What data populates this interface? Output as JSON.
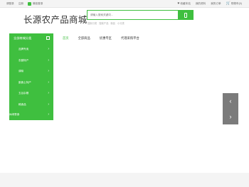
{
  "topbar": {
    "left": [
      "请登录",
      "注册"
    ],
    "wechat_label": "微信登录",
    "right": [
      {
        "icon": "heart-icon",
        "label": "收藏本站"
      },
      {
        "label": "我的资料"
      },
      {
        "label": "我的订单"
      }
    ],
    "cart_label": "购物车",
    "cart_count": "(0)"
  },
  "header": {
    "logo": "长源农产品商城",
    "search_placeholder": "请输入搜索关键词...",
    "hot_words": [
      "搜索分类",
      "搜索产品",
      "新品",
      "小分类"
    ]
  },
  "nav": {
    "category_head": "全部商城分类",
    "links": [
      "首页",
      "全部商品",
      "优惠专区",
      "代理采购平台"
    ],
    "active_index": 0
  },
  "categories": [
    {
      "label": "品牌专卖"
    },
    {
      "label": "农副特产"
    },
    {
      "label": "调味"
    },
    {
      "label": "副食土特产"
    },
    {
      "label": "五谷杂粮"
    },
    {
      "label": "稀食品"
    },
    {
      "label": "休闲零食"
    }
  ],
  "banner": {
    "prev": "‹",
    "next": "›"
  },
  "colors": {
    "accent": "#3fbf3f",
    "ctrl": "#7b7b7b",
    "cart": "#e74c3c"
  }
}
